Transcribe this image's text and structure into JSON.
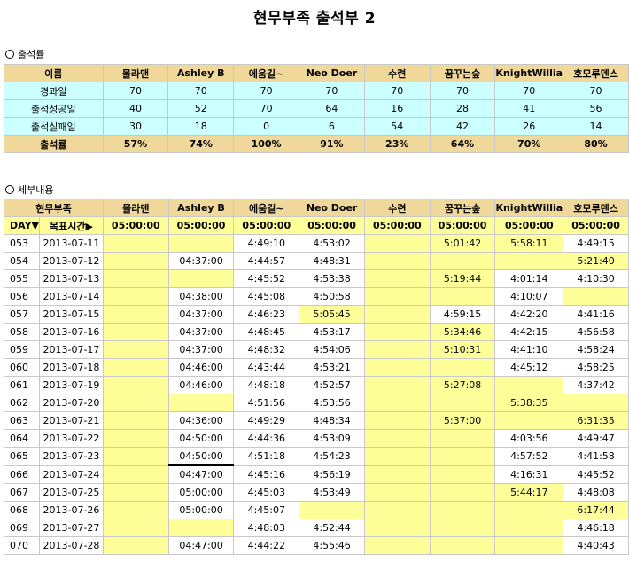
{
  "title": "현무부족 출석부 2",
  "section1": "출석률",
  "section2": "세부내용",
  "names": [
    "몰라맨",
    "Ashley B",
    "에움길~",
    "Neo Doer",
    "수련",
    "꿈꾸는숲",
    "KnightWillia",
    "호모루덴스"
  ],
  "stats_header": "이름",
  "stats_rows": [
    {
      "label": "경과일",
      "values": [
        "70",
        "70",
        "70",
        "70",
        "70",
        "70",
        "70",
        "70"
      ]
    },
    {
      "label": "출석성공일",
      "values": [
        "40",
        "52",
        "70",
        "64",
        "16",
        "28",
        "41",
        "56"
      ]
    },
    {
      "label": "출석실패일",
      "values": [
        "30",
        "18",
        "0",
        "6",
        "54",
        "42",
        "26",
        "14"
      ]
    },
    {
      "label": "출석률",
      "values": [
        "57%",
        "74%",
        "100%",
        "91%",
        "23%",
        "64%",
        "70%",
        "80%"
      ]
    }
  ],
  "detail_header": "현무부족",
  "day_label": "DAY▼",
  "target_label": "목표시간▶",
  "targets": [
    "05:00:00",
    "05:00:00",
    "05:00:00",
    "05:00:00",
    "05:00:00",
    "05:00:00",
    "05:00:00",
    "05:00:00"
  ],
  "rows": [
    {
      "day": "053",
      "date": "2013-07-11",
      "c": [
        "",
        "",
        "4:49:10",
        "4:53:02",
        "",
        "5:01:42",
        "5:58:11",
        "4:49:15"
      ],
      "y": [
        1,
        1,
        0,
        0,
        1,
        1,
        1,
        0
      ]
    },
    {
      "day": "054",
      "date": "2013-07-12",
      "c": [
        "",
        "04:37:00",
        "4:44:57",
        "4:48:31",
        "",
        "",
        "",
        "5:21:40"
      ],
      "y": [
        1,
        0,
        0,
        0,
        1,
        1,
        1,
        1
      ]
    },
    {
      "day": "055",
      "date": "2013-07-13",
      "c": [
        "",
        "",
        "4:45:52",
        "4:53:38",
        "",
        "5:19:44",
        "4:01:14",
        "4:10:30"
      ],
      "y": [
        1,
        1,
        0,
        0,
        1,
        1,
        0,
        0
      ]
    },
    {
      "day": "056",
      "date": "2013-07-14",
      "c": [
        "",
        "04:38:00",
        "4:45:08",
        "4:50:58",
        "",
        "",
        "4:10:07",
        ""
      ],
      "y": [
        1,
        0,
        0,
        0,
        1,
        1,
        0,
        1
      ]
    },
    {
      "day": "057",
      "date": "2013-07-15",
      "c": [
        "",
        "04:37:00",
        "4:46:23",
        "5:05:45",
        "",
        "4:59:15",
        "4:42:20",
        "4:41:16"
      ],
      "y": [
        1,
        0,
        0,
        1,
        1,
        0,
        0,
        0
      ]
    },
    {
      "day": "058",
      "date": "2013-07-16",
      "c": [
        "",
        "04:37:00",
        "4:48:45",
        "4:53:17",
        "",
        "5:34:46",
        "4:42:15",
        "4:56:58"
      ],
      "y": [
        1,
        0,
        0,
        0,
        1,
        1,
        0,
        0
      ]
    },
    {
      "day": "059",
      "date": "2013-07-17",
      "c": [
        "",
        "04:37:00",
        "4:48:32",
        "4:54:06",
        "",
        "5:10:31",
        "4:41:10",
        "4:58:24"
      ],
      "y": [
        1,
        0,
        0,
        0,
        1,
        1,
        0,
        0
      ]
    },
    {
      "day": "060",
      "date": "2013-07-18",
      "c": [
        "",
        "04:46:00",
        "4:43:44",
        "4:53:21",
        "",
        "",
        "4:45:12",
        "4:58:25"
      ],
      "y": [
        1,
        0,
        0,
        0,
        1,
        1,
        0,
        0
      ]
    },
    {
      "day": "061",
      "date": "2013-07-19",
      "c": [
        "",
        "04:46:00",
        "4:48:18",
        "4:52:57",
        "",
        "5:27:08",
        "",
        "4:37:42"
      ],
      "y": [
        1,
        0,
        0,
        0,
        1,
        1,
        1,
        0
      ]
    },
    {
      "day": "062",
      "date": "2013-07-20",
      "c": [
        "",
        "",
        "4:51:56",
        "4:53:56",
        "",
        "",
        "5:38:35",
        ""
      ],
      "y": [
        1,
        1,
        0,
        0,
        1,
        1,
        1,
        1
      ]
    },
    {
      "day": "063",
      "date": "2013-07-21",
      "c": [
        "",
        "04:36:00",
        "4:49:29",
        "4:48:34",
        "",
        "5:37:00",
        "",
        "6:31:35"
      ],
      "y": [
        1,
        0,
        0,
        0,
        1,
        1,
        1,
        1
      ]
    },
    {
      "day": "064",
      "date": "2013-07-22",
      "c": [
        "",
        "04:50:00",
        "4:44:36",
        "4:53:09",
        "",
        "",
        "4:03:56",
        "4:49:47"
      ],
      "y": [
        1,
        0,
        0,
        0,
        1,
        1,
        0,
        0
      ]
    },
    {
      "day": "065",
      "date": "2013-07-23",
      "c": [
        "",
        "04:50:00",
        "4:51:18",
        "4:54:23",
        "",
        "",
        "4:57:52",
        "4:41:58"
      ],
      "y": [
        1,
        0,
        0,
        0,
        1,
        1,
        0,
        0
      ]
    },
    {
      "day": "066",
      "date": "2013-07-24",
      "c": [
        "",
        "04:47:00",
        "4:45:16",
        "4:56:19",
        "",
        "",
        "4:16:31",
        "4:45:52"
      ],
      "y": [
        1,
        0,
        0,
        0,
        1,
        1,
        0,
        0
      ]
    },
    {
      "day": "067",
      "date": "2013-07-25",
      "c": [
        "",
        "05:00:00",
        "4:45:03",
        "4:53:49",
        "",
        "",
        "5:44:17",
        "4:48:08"
      ],
      "y": [
        1,
        0,
        0,
        0,
        1,
        1,
        1,
        0
      ]
    },
    {
      "day": "068",
      "date": "2013-07-26",
      "c": [
        "",
        "05:00:00",
        "4:45:07",
        "",
        "",
        "",
        "",
        "6:17:44"
      ],
      "y": [
        1,
        0,
        0,
        1,
        1,
        1,
        1,
        1
      ]
    },
    {
      "day": "069",
      "date": "2013-07-27",
      "c": [
        "",
        "",
        "4:48:03",
        "4:52:44",
        "",
        "",
        "",
        "4:46:18"
      ],
      "y": [
        1,
        1,
        0,
        0,
        1,
        1,
        1,
        0
      ]
    },
    {
      "day": "070",
      "date": "2013-07-28",
      "c": [
        "",
        "04:47:00",
        "4:44:22",
        "4:55:46",
        "",
        "",
        "",
        "4:40:43"
      ],
      "y": [
        1,
        0,
        0,
        0,
        1,
        1,
        1,
        0
      ]
    }
  ]
}
